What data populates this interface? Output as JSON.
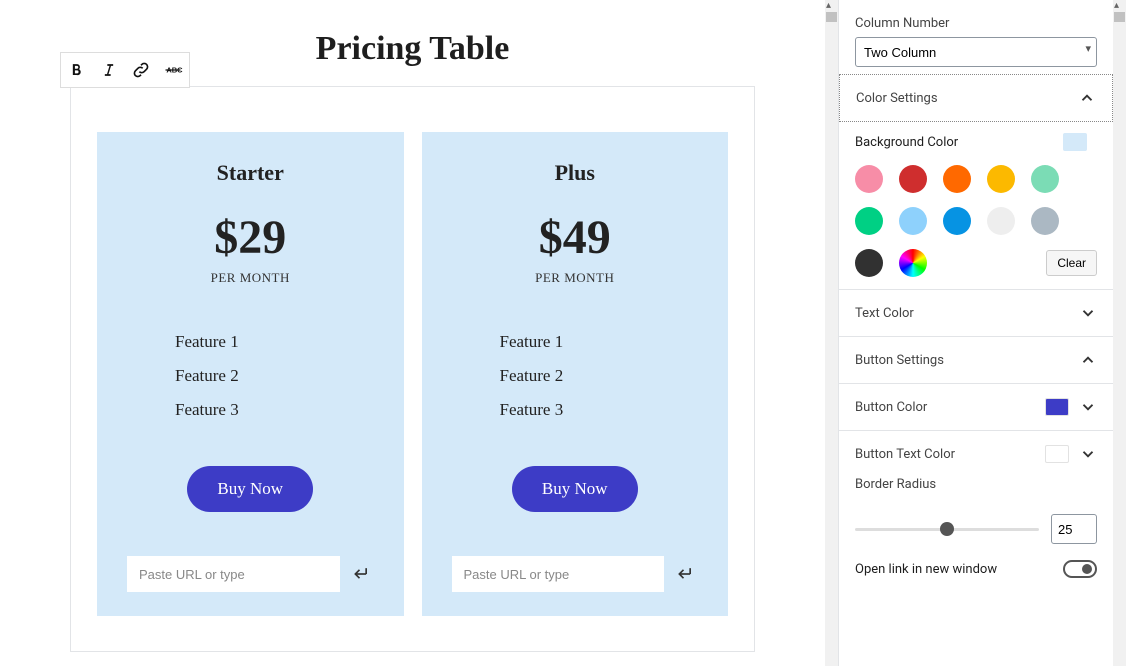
{
  "page": {
    "title": "Pricing Table"
  },
  "toolbar": {
    "bold": "Bold",
    "italic": "Italic",
    "link": "Link",
    "strike": "Strikethrough"
  },
  "cards": [
    {
      "title": "Starter",
      "price": "$29",
      "period": "PER MONTH",
      "features": [
        "Feature 1",
        "Feature 2",
        "Feature 3"
      ],
      "cta": "Buy Now",
      "url_placeholder": "Paste URL or type"
    },
    {
      "title": "Plus",
      "price": "$49",
      "period": "PER MONTH",
      "features": [
        "Feature 1",
        "Feature 2",
        "Feature 3"
      ],
      "cta": "Buy Now",
      "url_placeholder": "Paste URL or type"
    }
  ],
  "sidebar": {
    "column_number": {
      "label": "Column Number",
      "value": "Two Column"
    },
    "color_settings_label": "Color Settings",
    "background_color": {
      "label": "Background Color",
      "value": "#d4e9f9"
    },
    "palette": [
      "#f78da7",
      "#cf2e2e",
      "#ff6900",
      "#fcb900",
      "#7bdcb5",
      "#00d084",
      "#8ed1fc",
      "#0693e3",
      "#eeeeee",
      "#abb8c3",
      "#313131"
    ],
    "clear_label": "Clear",
    "text_color_label": "Text Color",
    "button_settings_label": "Button Settings",
    "button_color": {
      "label": "Button Color",
      "value": "#3d3cc6"
    },
    "button_text_color": {
      "label": "Button Text Color",
      "value": "#ffffff"
    },
    "border_radius": {
      "label": "Border Radius",
      "value": "25"
    },
    "open_new_window": {
      "label": "Open link in new window",
      "value": false
    }
  }
}
